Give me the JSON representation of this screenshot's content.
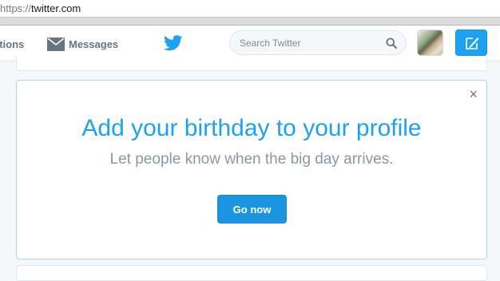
{
  "browser": {
    "url_scheme": "https://",
    "url_host": "twitter.com"
  },
  "nav": {
    "notifications_label": "ations",
    "messages_label": "Messages",
    "messages_icon": "envelope-icon",
    "logo_icon": "twitter-bird-icon",
    "search_placeholder": "Search Twitter",
    "search_icon": "magnifier-icon",
    "tweet_icon": "compose-tweet-icon",
    "accent": "#1da1f2"
  },
  "prompt_card": {
    "title": "Add your birthday to your profile",
    "subtitle": "Let people know when the big day arrives.",
    "button_label": "Go now",
    "close_glyph": "×"
  }
}
